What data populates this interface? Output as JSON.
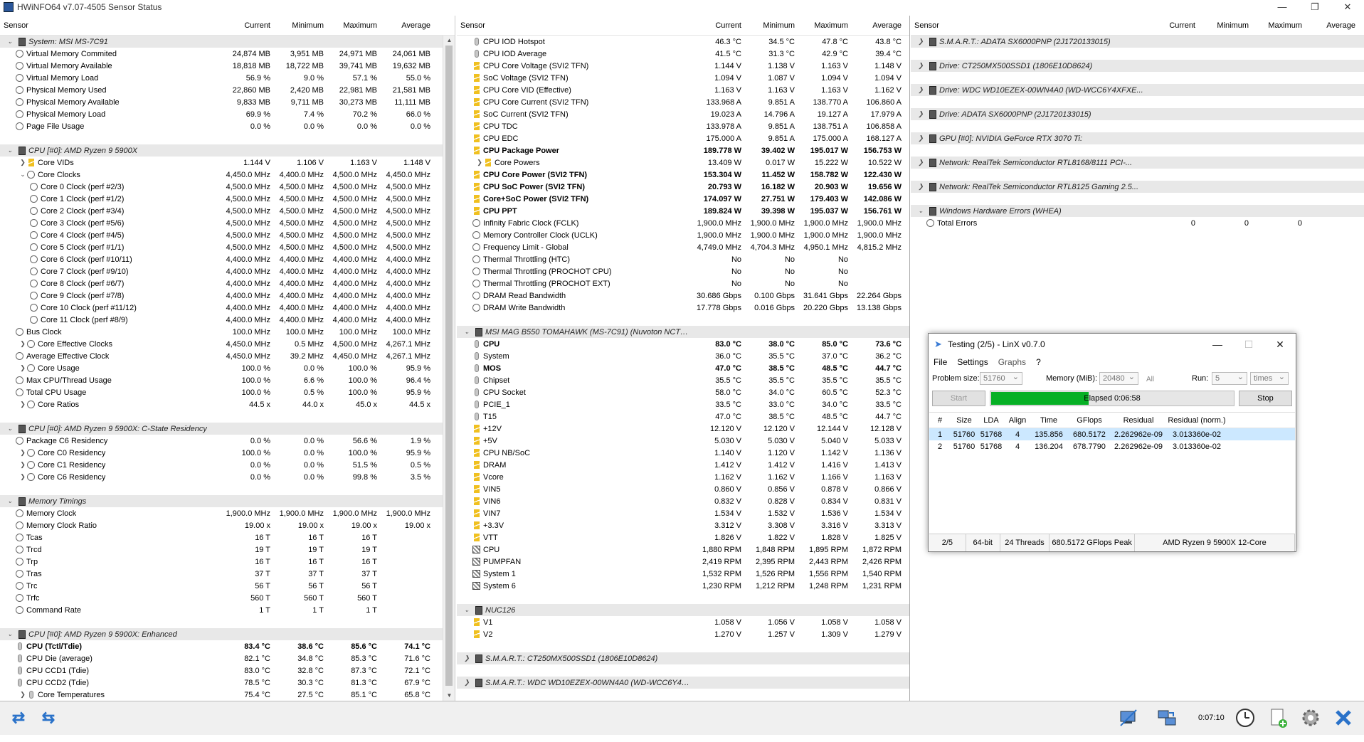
{
  "window": {
    "title": "HWiNFO64 v7.07-4505 Sensor Status"
  },
  "columns": {
    "sensor": "Sensor",
    "current": "Current",
    "minimum": "Minimum",
    "maximum": "Maximum",
    "average": "Average"
  },
  "panel1": [
    {
      "t": "g",
      "n": "System: MSI MS-7C91"
    },
    {
      "t": "r",
      "i": "clk",
      "n": "Virtual Memory Commited",
      "c": "24,874 MB",
      "mi": "3,951 MB",
      "ma": "24,971 MB",
      "av": "24,061 MB"
    },
    {
      "t": "r",
      "i": "clk",
      "n": "Virtual Memory Available",
      "c": "18,818 MB",
      "mi": "18,722 MB",
      "ma": "39,741 MB",
      "av": "19,632 MB"
    },
    {
      "t": "r",
      "i": "clk",
      "n": "Virtual Memory Load",
      "c": "56.9 %",
      "mi": "9.0 %",
      "ma": "57.1 %",
      "av": "55.0 %"
    },
    {
      "t": "r",
      "i": "clk",
      "n": "Physical Memory Used",
      "c": "22,860 MB",
      "mi": "2,420 MB",
      "ma": "22,981 MB",
      "av": "21,581 MB"
    },
    {
      "t": "r",
      "i": "clk",
      "n": "Physical Memory Available",
      "c": "9,833 MB",
      "mi": "9,711 MB",
      "ma": "30,273 MB",
      "av": "11,111 MB"
    },
    {
      "t": "r",
      "i": "clk",
      "n": "Physical Memory Load",
      "c": "69.9 %",
      "mi": "7.4 %",
      "ma": "70.2 %",
      "av": "66.0 %"
    },
    {
      "t": "r",
      "i": "clk",
      "n": "Page File Usage",
      "c": "0.0 %",
      "mi": "0.0 %",
      "ma": "0.0 %",
      "av": "0.0 %"
    },
    {
      "t": "s"
    },
    {
      "t": "g",
      "n": "CPU [#0]: AMD Ryzen 9 5900X"
    },
    {
      "t": "r",
      "i": "bolt",
      "x": 1,
      "n": "Core VIDs",
      "c": "1.144 V",
      "mi": "1.106 V",
      "ma": "1.163 V",
      "av": "1.148 V"
    },
    {
      "t": "r",
      "i": "clk",
      "x": 2,
      "n": "Core Clocks",
      "c": "4,450.0 MHz",
      "mi": "4,400.0 MHz",
      "ma": "4,500.0 MHz",
      "av": "4,450.0 MHz"
    },
    {
      "t": "r",
      "i": "clk",
      "d": 1,
      "n": "Core 0 Clock (perf #2/3)",
      "c": "4,500.0 MHz",
      "mi": "4,500.0 MHz",
      "ma": "4,500.0 MHz",
      "av": "4,500.0 MHz"
    },
    {
      "t": "r",
      "i": "clk",
      "d": 1,
      "n": "Core 1 Clock (perf #1/2)",
      "c": "4,500.0 MHz",
      "mi": "4,500.0 MHz",
      "ma": "4,500.0 MHz",
      "av": "4,500.0 MHz"
    },
    {
      "t": "r",
      "i": "clk",
      "d": 1,
      "n": "Core 2 Clock (perf #3/4)",
      "c": "4,500.0 MHz",
      "mi": "4,500.0 MHz",
      "ma": "4,500.0 MHz",
      "av": "4,500.0 MHz"
    },
    {
      "t": "r",
      "i": "clk",
      "d": 1,
      "n": "Core 3 Clock (perf #5/6)",
      "c": "4,500.0 MHz",
      "mi": "4,500.0 MHz",
      "ma": "4,500.0 MHz",
      "av": "4,500.0 MHz"
    },
    {
      "t": "r",
      "i": "clk",
      "d": 1,
      "n": "Core 4 Clock (perf #4/5)",
      "c": "4,500.0 MHz",
      "mi": "4,500.0 MHz",
      "ma": "4,500.0 MHz",
      "av": "4,500.0 MHz"
    },
    {
      "t": "r",
      "i": "clk",
      "d": 1,
      "n": "Core 5 Clock (perf #1/1)",
      "c": "4,500.0 MHz",
      "mi": "4,500.0 MHz",
      "ma": "4,500.0 MHz",
      "av": "4,500.0 MHz"
    },
    {
      "t": "r",
      "i": "clk",
      "d": 1,
      "n": "Core 6 Clock (perf #10/11)",
      "c": "4,400.0 MHz",
      "mi": "4,400.0 MHz",
      "ma": "4,400.0 MHz",
      "av": "4,400.0 MHz"
    },
    {
      "t": "r",
      "i": "clk",
      "d": 1,
      "n": "Core 7 Clock (perf #9/10)",
      "c": "4,400.0 MHz",
      "mi": "4,400.0 MHz",
      "ma": "4,400.0 MHz",
      "av": "4,400.0 MHz"
    },
    {
      "t": "r",
      "i": "clk",
      "d": 1,
      "n": "Core 8 Clock (perf #6/7)",
      "c": "4,400.0 MHz",
      "mi": "4,400.0 MHz",
      "ma": "4,400.0 MHz",
      "av": "4,400.0 MHz"
    },
    {
      "t": "r",
      "i": "clk",
      "d": 1,
      "n": "Core 9 Clock (perf #7/8)",
      "c": "4,400.0 MHz",
      "mi": "4,400.0 MHz",
      "ma": "4,400.0 MHz",
      "av": "4,400.0 MHz"
    },
    {
      "t": "r",
      "i": "clk",
      "d": 1,
      "n": "Core 10 Clock (perf #11/12)",
      "c": "4,400.0 MHz",
      "mi": "4,400.0 MHz",
      "ma": "4,400.0 MHz",
      "av": "4,400.0 MHz"
    },
    {
      "t": "r",
      "i": "clk",
      "d": 1,
      "n": "Core 11 Clock (perf #8/9)",
      "c": "4,400.0 MHz",
      "mi": "4,400.0 MHz",
      "ma": "4,400.0 MHz",
      "av": "4,400.0 MHz"
    },
    {
      "t": "r",
      "i": "clk",
      "n": "Bus Clock",
      "c": "100.0 MHz",
      "mi": "100.0 MHz",
      "ma": "100.0 MHz",
      "av": "100.0 MHz"
    },
    {
      "t": "r",
      "i": "clk",
      "x": 1,
      "n": "Core Effective Clocks",
      "c": "4,450.0 MHz",
      "mi": "0.5 MHz",
      "ma": "4,500.0 MHz",
      "av": "4,267.1 MHz"
    },
    {
      "t": "r",
      "i": "clk",
      "n": "Average Effective Clock",
      "c": "4,450.0 MHz",
      "mi": "39.2 MHz",
      "ma": "4,450.0 MHz",
      "av": "4,267.1 MHz"
    },
    {
      "t": "r",
      "i": "clk",
      "x": 1,
      "n": "Core Usage",
      "c": "100.0 %",
      "mi": "0.0 %",
      "ma": "100.0 %",
      "av": "95.9 %"
    },
    {
      "t": "r",
      "i": "clk",
      "n": "Max CPU/Thread Usage",
      "c": "100.0 %",
      "mi": "6.6 %",
      "ma": "100.0 %",
      "av": "96.4 %"
    },
    {
      "t": "r",
      "i": "clk",
      "n": "Total CPU Usage",
      "c": "100.0 %",
      "mi": "0.5 %",
      "ma": "100.0 %",
      "av": "95.9 %"
    },
    {
      "t": "r",
      "i": "clk",
      "x": 1,
      "n": "Core Ratios",
      "c": "44.5 x",
      "mi": "44.0 x",
      "ma": "45.0 x",
      "av": "44.5 x"
    },
    {
      "t": "s"
    },
    {
      "t": "g",
      "n": "CPU [#0]: AMD Ryzen 9 5900X: C-State Residency"
    },
    {
      "t": "r",
      "i": "clk",
      "n": "Package C6 Residency",
      "c": "0.0 %",
      "mi": "0.0 %",
      "ma": "56.6 %",
      "av": "1.9 %"
    },
    {
      "t": "r",
      "i": "clk",
      "x": 1,
      "n": "Core C0 Residency",
      "c": "100.0 %",
      "mi": "0.0 %",
      "ma": "100.0 %",
      "av": "95.9 %"
    },
    {
      "t": "r",
      "i": "clk",
      "x": 1,
      "n": "Core C1 Residency",
      "c": "0.0 %",
      "mi": "0.0 %",
      "ma": "51.5 %",
      "av": "0.5 %"
    },
    {
      "t": "r",
      "i": "clk",
      "x": 1,
      "n": "Core C6 Residency",
      "c": "0.0 %",
      "mi": "0.0 %",
      "ma": "99.8 %",
      "av": "3.5 %"
    },
    {
      "t": "s"
    },
    {
      "t": "g",
      "n": "Memory Timings"
    },
    {
      "t": "r",
      "i": "clk",
      "n": "Memory Clock",
      "c": "1,900.0 MHz",
      "mi": "1,900.0 MHz",
      "ma": "1,900.0 MHz",
      "av": "1,900.0 MHz"
    },
    {
      "t": "r",
      "i": "clk",
      "n": "Memory Clock Ratio",
      "c": "19.00 x",
      "mi": "19.00 x",
      "ma": "19.00 x",
      "av": "19.00 x"
    },
    {
      "t": "r",
      "i": "clk",
      "n": "Tcas",
      "c": "16 T",
      "mi": "16 T",
      "ma": "16 T",
      "av": ""
    },
    {
      "t": "r",
      "i": "clk",
      "n": "Trcd",
      "c": "19 T",
      "mi": "19 T",
      "ma": "19 T",
      "av": ""
    },
    {
      "t": "r",
      "i": "clk",
      "n": "Trp",
      "c": "16 T",
      "mi": "16 T",
      "ma": "16 T",
      "av": ""
    },
    {
      "t": "r",
      "i": "clk",
      "n": "Tras",
      "c": "37 T",
      "mi": "37 T",
      "ma": "37 T",
      "av": ""
    },
    {
      "t": "r",
      "i": "clk",
      "n": "Trc",
      "c": "56 T",
      "mi": "56 T",
      "ma": "56 T",
      "av": ""
    },
    {
      "t": "r",
      "i": "clk",
      "n": "Trfc",
      "c": "560 T",
      "mi": "560 T",
      "ma": "560 T",
      "av": ""
    },
    {
      "t": "r",
      "i": "clk",
      "n": "Command Rate",
      "c": "1 T",
      "mi": "1 T",
      "ma": "1 T",
      "av": ""
    },
    {
      "t": "s"
    },
    {
      "t": "g",
      "n": "CPU [#0]: AMD Ryzen 9 5900X: Enhanced"
    },
    {
      "t": "r",
      "i": "therm",
      "b": 1,
      "n": "CPU (Tctl/Tdie)",
      "c": "83.4 °C",
      "mi": "38.6 °C",
      "ma": "85.6 °C",
      "av": "74.1 °C"
    },
    {
      "t": "r",
      "i": "therm",
      "n": "CPU Die (average)",
      "c": "82.1 °C",
      "mi": "34.8 °C",
      "ma": "85.3 °C",
      "av": "71.6 °C"
    },
    {
      "t": "r",
      "i": "therm",
      "n": "CPU CCD1 (Tdie)",
      "c": "83.0 °C",
      "mi": "32.8 °C",
      "ma": "87.3 °C",
      "av": "72.1 °C"
    },
    {
      "t": "r",
      "i": "therm",
      "n": "CPU CCD2 (Tdie)",
      "c": "78.5 °C",
      "mi": "30.3 °C",
      "ma": "81.3 °C",
      "av": "67.9 °C"
    },
    {
      "t": "r",
      "i": "therm",
      "x": 1,
      "n": "Core Temperatures",
      "c": "75.4 °C",
      "mi": "27.5 °C",
      "ma": "85.1 °C",
      "av": "65.8 °C"
    }
  ],
  "panel2": [
    {
      "t": "r",
      "i": "therm",
      "n": "CPU IOD Hotspot",
      "c": "46.3 °C",
      "mi": "34.5 °C",
      "ma": "47.8 °C",
      "av": "43.8 °C"
    },
    {
      "t": "r",
      "i": "therm",
      "n": "CPU IOD Average",
      "c": "41.5 °C",
      "mi": "31.3 °C",
      "ma": "42.9 °C",
      "av": "39.4 °C"
    },
    {
      "t": "r",
      "i": "bolt",
      "n": "CPU Core Voltage (SVI2 TFN)",
      "c": "1.144 V",
      "mi": "1.138 V",
      "ma": "1.163 V",
      "av": "1.148 V"
    },
    {
      "t": "r",
      "i": "bolt",
      "n": "SoC Voltage (SVI2 TFN)",
      "c": "1.094 V",
      "mi": "1.087 V",
      "ma": "1.094 V",
      "av": "1.094 V"
    },
    {
      "t": "r",
      "i": "bolt",
      "n": "CPU Core VID (Effective)",
      "c": "1.163 V",
      "mi": "1.163 V",
      "ma": "1.163 V",
      "av": "1.162 V"
    },
    {
      "t": "r",
      "i": "bolt",
      "n": "CPU Core Current (SVI2 TFN)",
      "c": "133.968 A",
      "mi": "9.851 A",
      "ma": "138.770 A",
      "av": "106.860 A"
    },
    {
      "t": "r",
      "i": "bolt",
      "n": "SoC Current (SVI2 TFN)",
      "c": "19.023 A",
      "mi": "14.796 A",
      "ma": "19.127 A",
      "av": "17.979 A"
    },
    {
      "t": "r",
      "i": "bolt",
      "n": "CPU TDC",
      "c": "133.978 A",
      "mi": "9.851 A",
      "ma": "138.751 A",
      "av": "106.858 A"
    },
    {
      "t": "r",
      "i": "bolt",
      "n": "CPU EDC",
      "c": "175.000 A",
      "mi": "9.851 A",
      "ma": "175.000 A",
      "av": "168.127 A"
    },
    {
      "t": "r",
      "i": "bolt",
      "b": 1,
      "n": "CPU Package Power",
      "c": "189.778 W",
      "mi": "39.402 W",
      "ma": "195.017 W",
      "av": "156.753 W"
    },
    {
      "t": "r",
      "i": "bolt",
      "x": 1,
      "n": "Core Powers",
      "c": "13.409 W",
      "mi": "0.017 W",
      "ma": "15.222 W",
      "av": "10.522 W"
    },
    {
      "t": "r",
      "i": "bolt",
      "b": 1,
      "n": "CPU Core Power (SVI2 TFN)",
      "c": "153.304 W",
      "mi": "11.452 W",
      "ma": "158.782 W",
      "av": "122.430 W"
    },
    {
      "t": "r",
      "i": "bolt",
      "b": 1,
      "n": "CPU SoC Power (SVI2 TFN)",
      "c": "20.793 W",
      "mi": "16.182 W",
      "ma": "20.903 W",
      "av": "19.656 W"
    },
    {
      "t": "r",
      "i": "bolt",
      "b": 1,
      "n": "Core+SoC Power (SVI2 TFN)",
      "c": "174.097 W",
      "mi": "27.751 W",
      "ma": "179.403 W",
      "av": "142.086 W"
    },
    {
      "t": "r",
      "i": "bolt",
      "b": 1,
      "n": "CPU PPT",
      "c": "189.824 W",
      "mi": "39.398 W",
      "ma": "195.037 W",
      "av": "156.761 W"
    },
    {
      "t": "r",
      "i": "clk",
      "n": "Infinity Fabric Clock (FCLK)",
      "c": "1,900.0 MHz",
      "mi": "1,900.0 MHz",
      "ma": "1,900.0 MHz",
      "av": "1,900.0 MHz"
    },
    {
      "t": "r",
      "i": "clk",
      "n": "Memory Controller Clock (UCLK)",
      "c": "1,900.0 MHz",
      "mi": "1,900.0 MHz",
      "ma": "1,900.0 MHz",
      "av": "1,900.0 MHz"
    },
    {
      "t": "r",
      "i": "clk",
      "n": "Frequency Limit - Global",
      "c": "4,749.0 MHz",
      "mi": "4,704.3 MHz",
      "ma": "4,950.1 MHz",
      "av": "4,815.2 MHz"
    },
    {
      "t": "r",
      "i": "clk",
      "n": "Thermal Throttling (HTC)",
      "c": "No",
      "mi": "No",
      "ma": "No",
      "av": ""
    },
    {
      "t": "r",
      "i": "clk",
      "n": "Thermal Throttling (PROCHOT CPU)",
      "c": "No",
      "mi": "No",
      "ma": "No",
      "av": ""
    },
    {
      "t": "r",
      "i": "clk",
      "n": "Thermal Throttling (PROCHOT EXT)",
      "c": "No",
      "mi": "No",
      "ma": "No",
      "av": ""
    },
    {
      "t": "r",
      "i": "clk",
      "n": "DRAM Read Bandwidth",
      "c": "30.686 Gbps",
      "mi": "0.100 Gbps",
      "ma": "31.641 Gbps",
      "av": "22.264 Gbps"
    },
    {
      "t": "r",
      "i": "clk",
      "n": "DRAM Write Bandwidth",
      "c": "17.778 Gbps",
      "mi": "0.016 Gbps",
      "ma": "20.220 Gbps",
      "av": "13.138 Gbps"
    },
    {
      "t": "s"
    },
    {
      "t": "g",
      "n": "MSI MAG B550 TOMAHAWK (MS-7C91) (Nuvoton NCT668..."
    },
    {
      "t": "r",
      "i": "therm",
      "b": 1,
      "n": "CPU",
      "c": "83.0 °C",
      "mi": "38.0 °C",
      "ma": "85.0 °C",
      "av": "73.6 °C"
    },
    {
      "t": "r",
      "i": "therm",
      "n": "System",
      "c": "36.0 °C",
      "mi": "35.5 °C",
      "ma": "37.0 °C",
      "av": "36.2 °C"
    },
    {
      "t": "r",
      "i": "therm",
      "b": 1,
      "n": "MOS",
      "c": "47.0 °C",
      "mi": "38.5 °C",
      "ma": "48.5 °C",
      "av": "44.7 °C"
    },
    {
      "t": "r",
      "i": "therm",
      "n": "Chipset",
      "c": "35.5 °C",
      "mi": "35.5 °C",
      "ma": "35.5 °C",
      "av": "35.5 °C"
    },
    {
      "t": "r",
      "i": "therm",
      "n": "CPU Socket",
      "c": "58.0 °C",
      "mi": "34.0 °C",
      "ma": "60.5 °C",
      "av": "52.3 °C"
    },
    {
      "t": "r",
      "i": "therm",
      "n": "PCIE_1",
      "c": "33.5 °C",
      "mi": "33.0 °C",
      "ma": "34.0 °C",
      "av": "33.5 °C"
    },
    {
      "t": "r",
      "i": "therm",
      "n": "T15",
      "c": "47.0 °C",
      "mi": "38.5 °C",
      "ma": "48.5 °C",
      "av": "44.7 °C"
    },
    {
      "t": "r",
      "i": "bolt",
      "n": "+12V",
      "c": "12.120 V",
      "mi": "12.120 V",
      "ma": "12.144 V",
      "av": "12.128 V"
    },
    {
      "t": "r",
      "i": "bolt",
      "n": "+5V",
      "c": "5.030 V",
      "mi": "5.030 V",
      "ma": "5.040 V",
      "av": "5.033 V"
    },
    {
      "t": "r",
      "i": "bolt",
      "n": "CPU NB/SoC",
      "c": "1.140 V",
      "mi": "1.120 V",
      "ma": "1.142 V",
      "av": "1.136 V"
    },
    {
      "t": "r",
      "i": "bolt",
      "n": "DRAM",
      "c": "1.412 V",
      "mi": "1.412 V",
      "ma": "1.416 V",
      "av": "1.413 V"
    },
    {
      "t": "r",
      "i": "bolt",
      "n": "Vcore",
      "c": "1.162 V",
      "mi": "1.162 V",
      "ma": "1.166 V",
      "av": "1.163 V"
    },
    {
      "t": "r",
      "i": "bolt",
      "n": "VIN5",
      "c": "0.860 V",
      "mi": "0.856 V",
      "ma": "0.878 V",
      "av": "0.866 V"
    },
    {
      "t": "r",
      "i": "bolt",
      "n": "VIN6",
      "c": "0.832 V",
      "mi": "0.828 V",
      "ma": "0.834 V",
      "av": "0.831 V"
    },
    {
      "t": "r",
      "i": "bolt",
      "n": "VIN7",
      "c": "1.534 V",
      "mi": "1.532 V",
      "ma": "1.536 V",
      "av": "1.534 V"
    },
    {
      "t": "r",
      "i": "bolt",
      "n": "+3.3V",
      "c": "3.312 V",
      "mi": "3.308 V",
      "ma": "3.316 V",
      "av": "3.313 V"
    },
    {
      "t": "r",
      "i": "bolt",
      "n": "VTT",
      "c": "1.826 V",
      "mi": "1.822 V",
      "ma": "1.828 V",
      "av": "1.825 V"
    },
    {
      "t": "r",
      "i": "fan",
      "n": "CPU",
      "c": "1,880 RPM",
      "mi": "1,848 RPM",
      "ma": "1,895 RPM",
      "av": "1,872 RPM"
    },
    {
      "t": "r",
      "i": "fan",
      "n": "PUMPFAN",
      "c": "2,419 RPM",
      "mi": "2,395 RPM",
      "ma": "2,443 RPM",
      "av": "2,426 RPM"
    },
    {
      "t": "r",
      "i": "fan",
      "n": "System 1",
      "c": "1,532 RPM",
      "mi": "1,526 RPM",
      "ma": "1,556 RPM",
      "av": "1,540 RPM"
    },
    {
      "t": "r",
      "i": "fan",
      "n": "System 6",
      "c": "1,230 RPM",
      "mi": "1,212 RPM",
      "ma": "1,248 RPM",
      "av": "1,231 RPM"
    },
    {
      "t": "s"
    },
    {
      "t": "g",
      "n": "NUC126"
    },
    {
      "t": "r",
      "i": "bolt",
      "n": "V1",
      "c": "1.058 V",
      "mi": "1.056 V",
      "ma": "1.058 V",
      "av": "1.058 V"
    },
    {
      "t": "r",
      "i": "bolt",
      "n": "V2",
      "c": "1.270 V",
      "mi": "1.257 V",
      "ma": "1.309 V",
      "av": "1.279 V"
    },
    {
      "t": "s"
    },
    {
      "t": "g",
      "x": 1,
      "n": "S.M.A.R.T.: CT250MX500SSD1 (1806E10D8624)"
    },
    {
      "t": "s"
    },
    {
      "t": "g",
      "x": 1,
      "n": "S.M.A.R.T.: WDC WD10EZEX-00WN4A0 (WD-WCC6Y4XF..."
    }
  ],
  "panel3": [
    {
      "t": "g",
      "x": 1,
      "n": "S.M.A.R.T.: ADATA SX6000PNP (2J1720133015)"
    },
    {
      "t": "s"
    },
    {
      "t": "g",
      "x": 1,
      "n": "Drive: CT250MX500SSD1 (1806E10D8624)"
    },
    {
      "t": "s"
    },
    {
      "t": "g",
      "x": 1,
      "n": "Drive: WDC WD10EZEX-00WN4A0 (WD-WCC6Y4XFXE..."
    },
    {
      "t": "s"
    },
    {
      "t": "g",
      "x": 1,
      "n": "Drive: ADATA SX6000PNP (2J1720133015)"
    },
    {
      "t": "s"
    },
    {
      "t": "g",
      "x": 1,
      "n": "GPU [#0]: NVIDIA GeForce RTX 3070 Ti:"
    },
    {
      "t": "s"
    },
    {
      "t": "g",
      "x": 1,
      "n": "Network: RealTek Semiconductor RTL8168/8111 PCI-..."
    },
    {
      "t": "s"
    },
    {
      "t": "g",
      "x": 1,
      "n": "Network: RealTek Semiconductor RTL8125 Gaming 2.5..."
    },
    {
      "t": "s"
    },
    {
      "t": "g",
      "x": 2,
      "n": "Windows Hardware Errors (WHEA)"
    },
    {
      "t": "r",
      "i": "clk",
      "n": "Total Errors",
      "c": "0",
      "mi": "0",
      "ma": "0",
      "av": ""
    }
  ],
  "status": {
    "clock": "0:07:10"
  },
  "linx": {
    "title": "Testing (2/5) - LinX v0.7.0",
    "menu": [
      "File",
      "Settings",
      "Graphs",
      "?"
    ],
    "problem_size_label": "Problem size:",
    "problem_size": "51760",
    "memory_label": "Memory (MiB):",
    "memory": "20480",
    "all_label": "All",
    "run_label": "Run:",
    "run": "5",
    "times": "times",
    "start_label": "Start",
    "stop_label": "Stop",
    "elapsed": "Elapsed 0:06:58",
    "progress_fraction": 0.4,
    "table_headers": [
      "#",
      "Size",
      "LDA",
      "Align",
      "Time",
      "GFlops",
      "Residual",
      "Residual (norm.)"
    ],
    "rows": [
      [
        "1",
        "51760",
        "51768",
        "4",
        "135.856",
        "680.5172",
        "2.262962e-09",
        "3.013360e-02"
      ],
      [
        "2",
        "51760",
        "51768",
        "4",
        "136.204",
        "678.7790",
        "2.262962e-09",
        "3.013360e-02"
      ]
    ],
    "status": [
      "2/5",
      "64-bit",
      "24 Threads",
      "680.5172 GFlops Peak",
      "AMD Ryzen 9 5900X 12-Core"
    ]
  }
}
